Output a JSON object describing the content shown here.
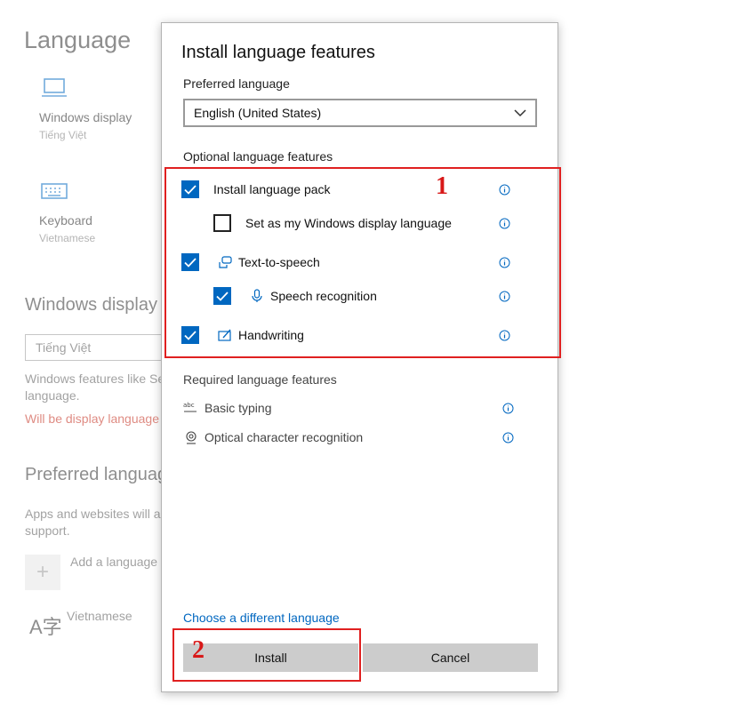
{
  "background": {
    "title": "Language",
    "tiles": [
      {
        "name": "Windows display",
        "sub": "Tiếng Việt",
        "icon": "laptop-icon"
      },
      {
        "name": "Keyboard",
        "sub": "Vietnamese",
        "icon": "keyboard-icon"
      }
    ],
    "windows_display_heading": "Windows display",
    "display_select_value": "Tiếng Việt",
    "windows_features_text": "Windows features like Se language.",
    "will_be_display_text": "Will be display language",
    "preferred_heading": "Preferred languag",
    "apps_text": "Apps and websites will a support.",
    "add_language_label": "Add a language",
    "language_item": "Vietnamese"
  },
  "dialog": {
    "title": "Install language features",
    "preferred_language_label": "Preferred language",
    "preferred_language_value": "English (United States)",
    "optional_header": "Optional language features",
    "optional_features": [
      {
        "label": "Install language pack",
        "checked": true,
        "icon": ""
      },
      {
        "label": "Set as my Windows display language",
        "checked": false,
        "icon": ""
      },
      {
        "label": "Text-to-speech",
        "checked": true,
        "icon": "speech-bubble-icon"
      },
      {
        "label": "Speech recognition",
        "checked": true,
        "icon": "microphone-icon"
      },
      {
        "label": "Handwriting",
        "checked": true,
        "icon": "pen-icon"
      }
    ],
    "required_header": "Required language features",
    "required_features": [
      {
        "label": "Basic typing",
        "icon": "abc-typing-icon"
      },
      {
        "label": "Optical character recognition",
        "icon": "camera-ocr-icon"
      }
    ],
    "choose_link": "Choose a different language",
    "install_button": "Install",
    "cancel_button": "Cancel"
  },
  "annotations": {
    "label_1": "1",
    "label_2": "2",
    "color": "#e02020"
  },
  "colors": {
    "accent": "#0067c0",
    "button_bg": "#cccccc"
  }
}
